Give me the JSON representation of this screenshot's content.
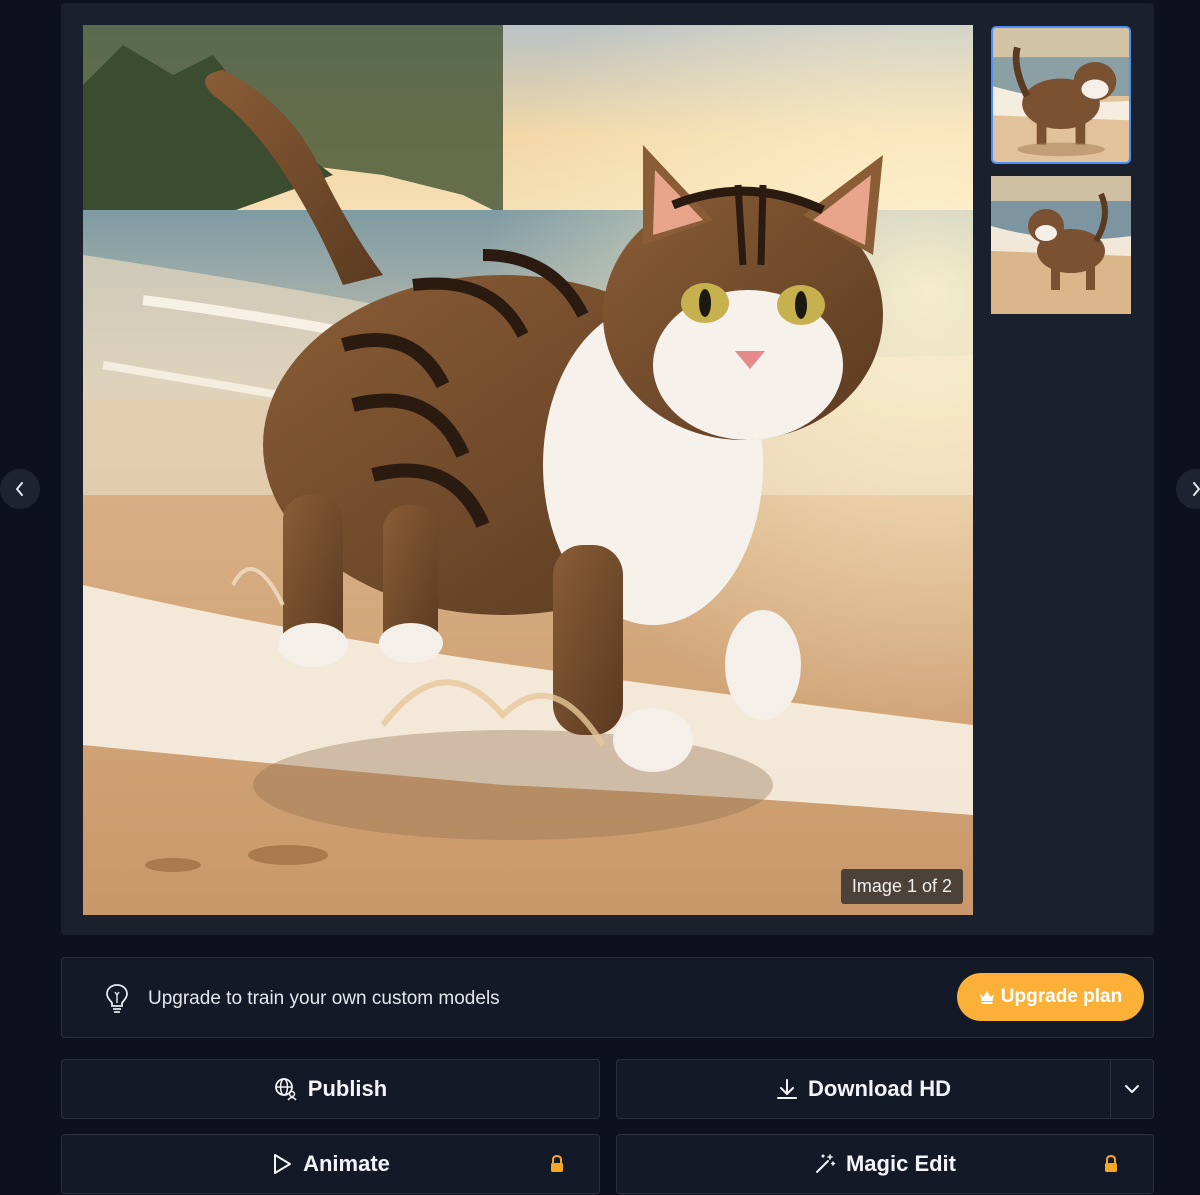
{
  "viewer": {
    "counter": "Image 1 of 2"
  },
  "banner": {
    "text": "Upgrade to train your own custom models",
    "upgrade_label": "Upgrade plan"
  },
  "actions": {
    "publish": "Publish",
    "download": "Download HD",
    "animate": "Animate",
    "magic_edit": "Magic Edit"
  },
  "colors": {
    "background": "#0d111e",
    "panel": "#1b202d",
    "accent_upgrade": "#fbb038",
    "selected_thumb_border": "#4d8ff5",
    "lock": "#f5a623"
  }
}
